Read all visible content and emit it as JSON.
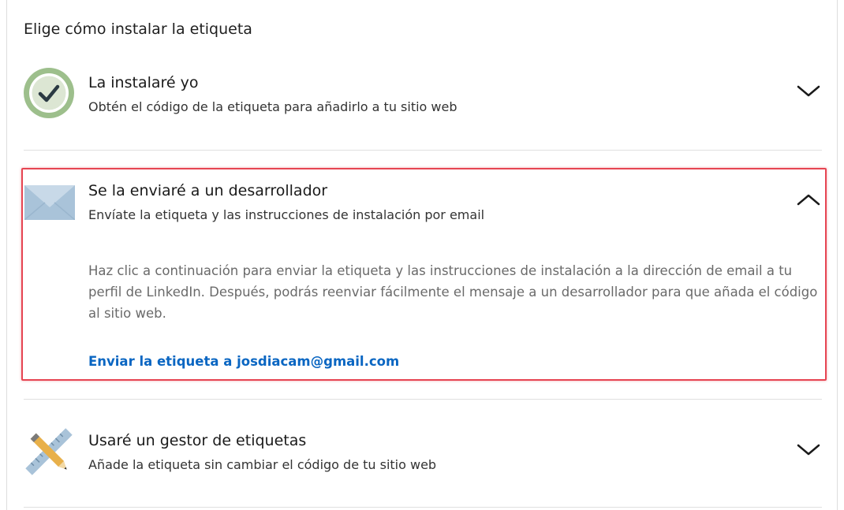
{
  "page": {
    "title": "Elige cómo instalar la etiqueta"
  },
  "options": [
    {
      "title": "La instalaré yo",
      "subtitle": "Obtén el código de la etiqueta para añadirlo a tu sitio web",
      "icon": "checkmark-circle-icon",
      "expanded": false
    },
    {
      "title": "Se la enviaré a un desarrollador",
      "subtitle": "Envíate la etiqueta y las instrucciones de instalación por email",
      "icon": "envelope-icon",
      "expanded": true,
      "description": "Haz clic a continuación para enviar la etiqueta y las instrucciones de instalación a la dirección de email a tu perfil de LinkedIn. Después, podrás reenviar fácilmente el mensaje a un desarrollador para que añada el código al sitio web.",
      "link": "Enviar la etiqueta a josdiacam@gmail.com"
    },
    {
      "title": "Usaré un gestor de etiquetas",
      "subtitle": "Añade la etiqueta sin cambiar el código de tu sitio web",
      "icon": "ruler-pencil-icon",
      "expanded": false
    }
  ],
  "colors": {
    "accent": "#0a66c2",
    "highlight_border": "#e64552",
    "check_green": "#9dbf8c",
    "envelope": "#a9c3d9"
  }
}
